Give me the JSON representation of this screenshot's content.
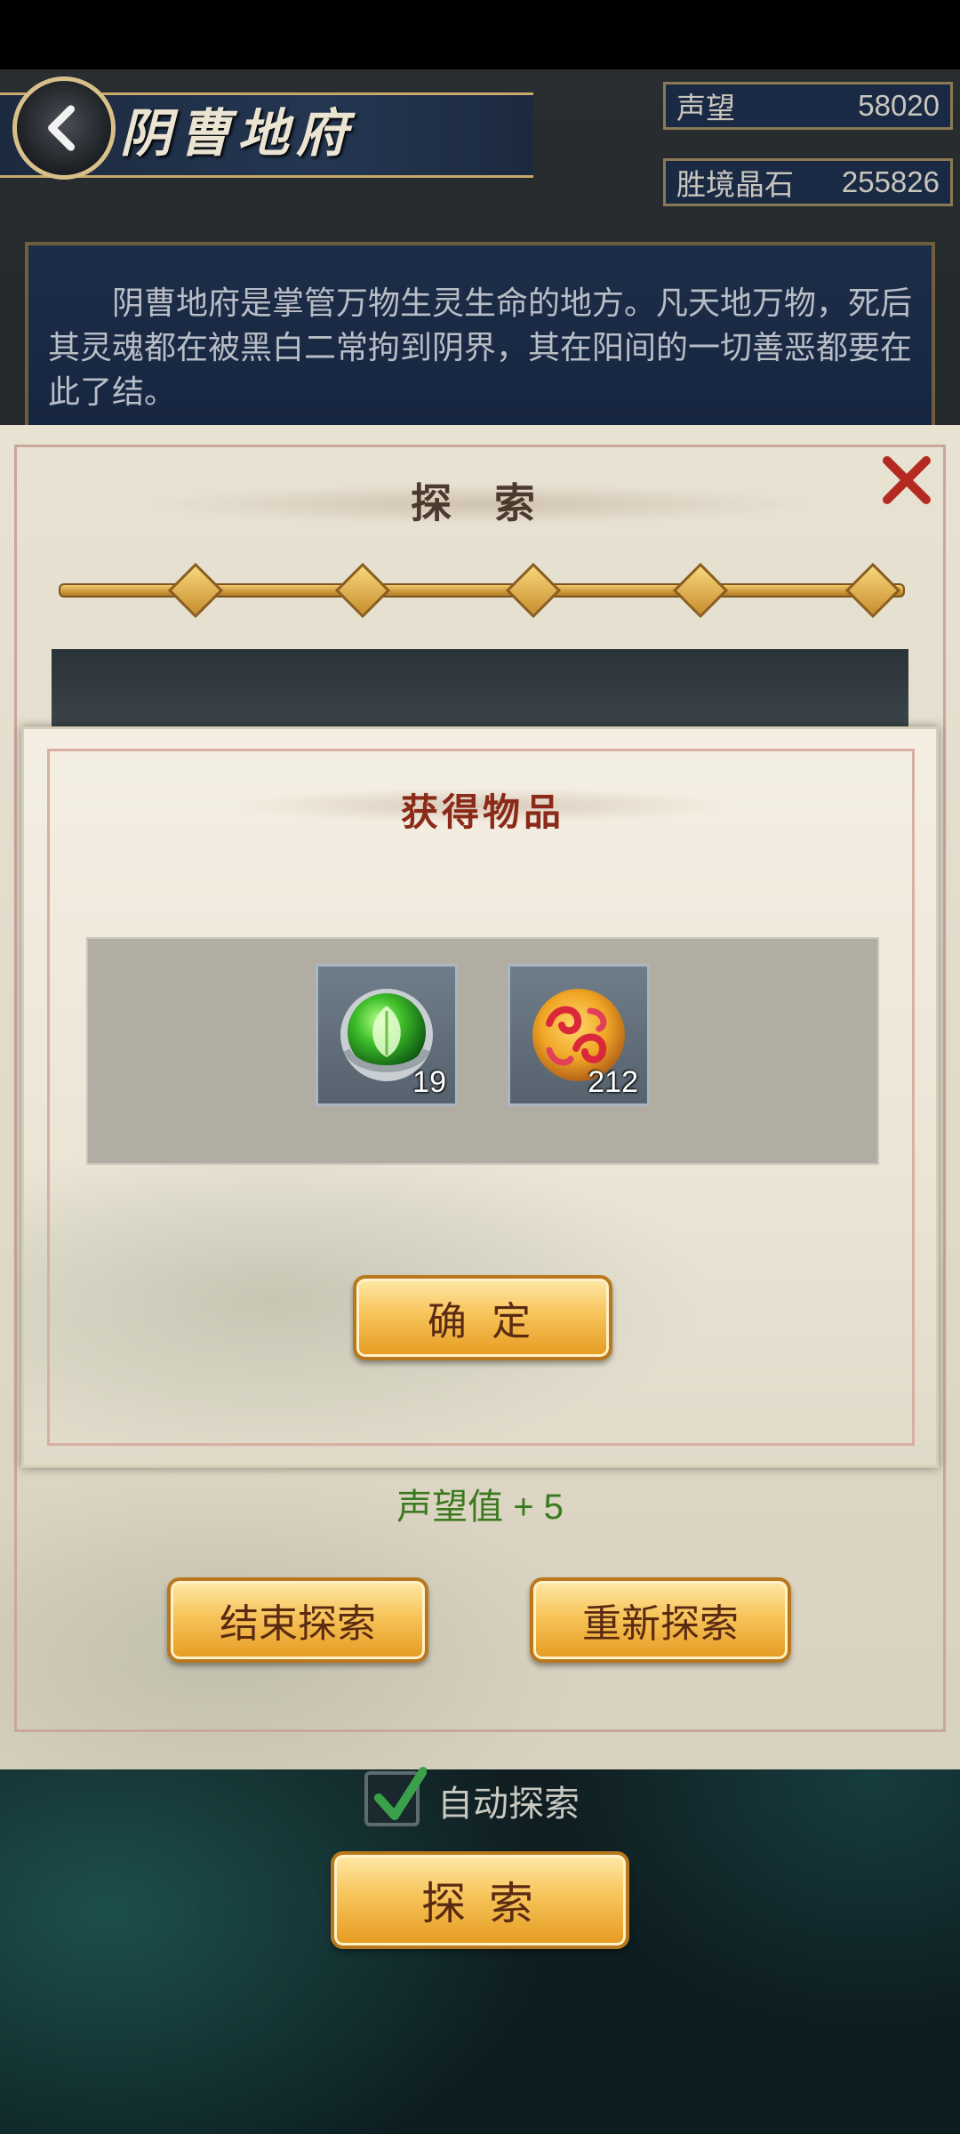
{
  "header": {
    "title": "阴曹地府",
    "stats": [
      {
        "label": "声望",
        "value": "58020"
      },
      {
        "label": "胜境晶石",
        "value": "255826"
      }
    ]
  },
  "description": "阴曹地府是掌管万物生灵生命的地方。凡天地万物，死后其灵魂都在被黑白二常拘到阴界，其在阳间的一切善恶都要在此了结。",
  "explore_panel": {
    "title": "探 索",
    "progress_steps": 5,
    "reputation_gain": "声望值 + 5",
    "end_button": "结束探索",
    "restart_button": "重新探索"
  },
  "reward_dialog": {
    "title": "获得物品",
    "items": [
      {
        "icon": "green-leaf-orb-icon",
        "count": "19"
      },
      {
        "icon": "red-gold-cloud-orb-icon",
        "count": "212"
      }
    ],
    "confirm_button": "确 定"
  },
  "auto_explore": {
    "label": "自动探索",
    "checked": true
  },
  "explore_button": "探 索",
  "colors": {
    "gold_button": "#f7c45a",
    "reward_title": "#8b2a18",
    "gain_text": "#3c7a20"
  }
}
